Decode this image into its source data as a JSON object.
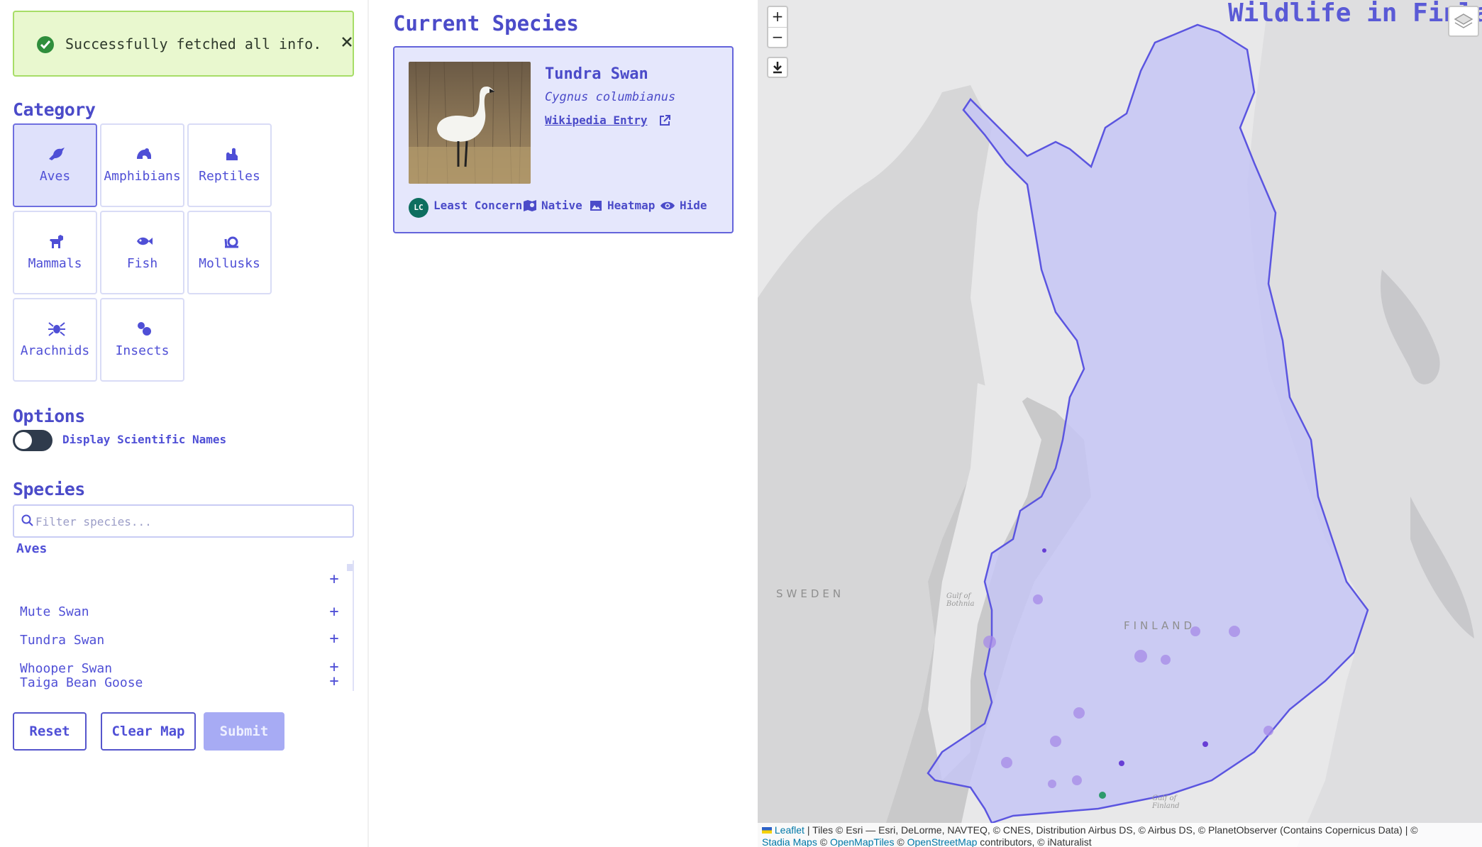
{
  "toast": {
    "message": "Successfully fetched all info."
  },
  "category": {
    "title": "Category",
    "items": [
      {
        "label": "Aves",
        "icon": "bird-icon",
        "active": true
      },
      {
        "label": "Amphibians",
        "icon": "frog-icon",
        "active": false
      },
      {
        "label": "Reptiles",
        "icon": "turtle-icon",
        "active": false
      },
      {
        "label": "Mammals",
        "icon": "dog-icon",
        "active": false
      },
      {
        "label": "Fish",
        "icon": "fish-icon",
        "active": false
      },
      {
        "label": "Mollusks",
        "icon": "snail-icon",
        "active": false
      },
      {
        "label": "Arachnids",
        "icon": "spider-icon",
        "active": false
      },
      {
        "label": "Insects",
        "icon": "bug-icon",
        "active": false
      }
    ]
  },
  "options": {
    "title": "Options",
    "scientific_names_label": "Display Scientific Names",
    "scientific_names_on": false
  },
  "species": {
    "title": "Species",
    "filter_placeholder": "Filter species...",
    "group": "Aves",
    "items": [
      "Mute Swan",
      "Tundra Swan",
      "Whooper Swan",
      "Taiga Bean Goose"
    ]
  },
  "buttons": {
    "reset": "Reset",
    "clear_map": "Clear Map",
    "submit": "Submit"
  },
  "current": {
    "title": "Current Species",
    "name": "Tundra Swan",
    "scientific": "Cygnus columbianus",
    "wiki": "Wikipedia Entry",
    "status_badge": "LC",
    "status": "Least Concern",
    "native": "Native",
    "heatmap": "Heatmap",
    "hide": "Hide"
  },
  "map": {
    "title": "Wildlife in Finla",
    "zoom_in": "+",
    "zoom_out": "−",
    "labels": {
      "sweden": "SWEDEN",
      "finland": "FINLAND",
      "gulf_bothnia": "Gulf of Bothnia",
      "gulf_finland": "Gulf of Finland"
    },
    "attribution_leaflet": "Leaflet",
    "attribution_rest": " | Tiles © Esri — Esri, DeLorme, NAVTEQ, © CNES, Distribution Airbus DS, © Airbus DS, © PlanetObserver (Contains Copernicus Data) | © ",
    "attribution_stadia": "Stadia Maps",
    "attribution_omt": "OpenMapTiles",
    "attribution_osm": "OpenStreetMap",
    "attribution_tail": " contributors, © iNaturalist"
  },
  "colors": {
    "accent": "#4f4fd6",
    "overlay": "#b8b8f6",
    "toast_bg": "#e9f8cf"
  }
}
